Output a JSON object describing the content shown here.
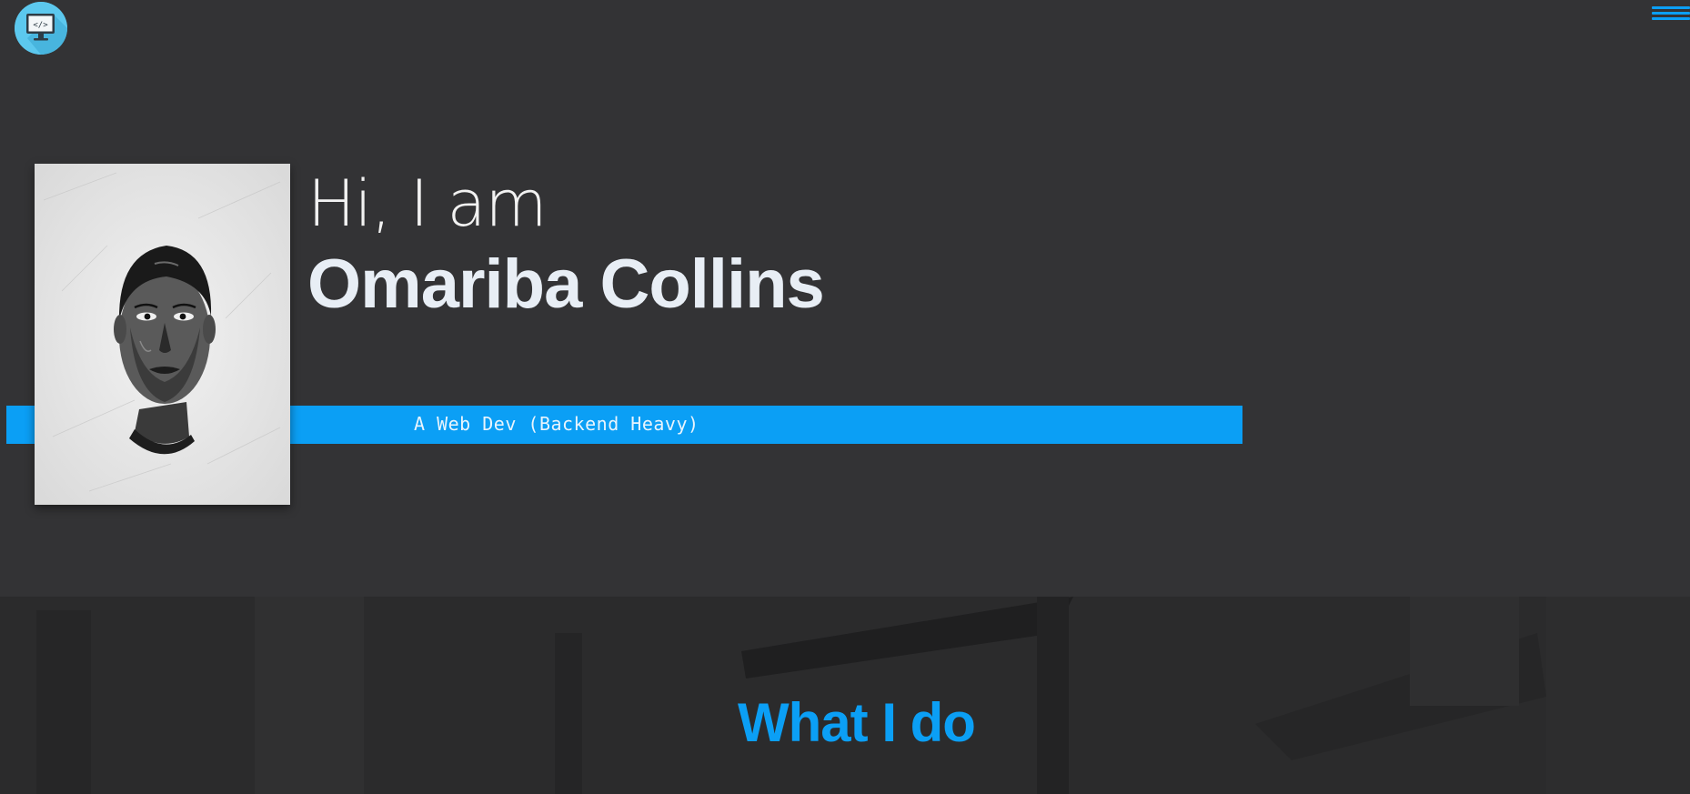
{
  "logo": {
    "icon": "monitor-code-icon",
    "glyph": "</>"
  },
  "nav": {
    "menu_icon": "hamburger-menu-icon"
  },
  "hero": {
    "greeting": "Hi, I am",
    "name": "Omariba Collins",
    "tagline": "A Web Dev (Backend Heavy)"
  },
  "section": {
    "title": "What I do"
  },
  "colors": {
    "accent": "#0b9ff5",
    "background": "#333335",
    "section_background": "#2a2a2b",
    "logo_circle": "#5cc8ee"
  }
}
